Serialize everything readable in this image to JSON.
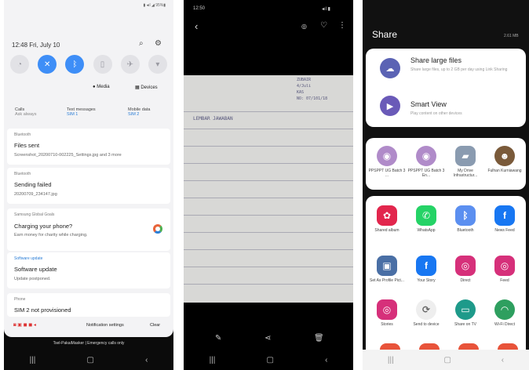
{
  "panel1": {
    "status_right": "▮ ◂ıl ◢ 95%▮",
    "time_date": "12:48  Fri, July 10",
    "media_label": "Media",
    "devices_label": "Devices",
    "sims": [
      {
        "label": "Calls",
        "value": "Ask always"
      },
      {
        "label": "Text messages",
        "value": "SIM 1"
      },
      {
        "label": "Mobile data",
        "value": "SIM 2"
      }
    ],
    "notifications": [
      {
        "app": "Bluetooth",
        "title": "Files sent",
        "text": "Screenshot_20200710-002225_Settings.jpg and 3 more"
      },
      {
        "app": "Bluetooth",
        "title": "Sending failed",
        "text": "20200709_234147.jpg"
      },
      {
        "app": "Samsung Global Goals",
        "title": "Charging your phone?",
        "text": "Earn money for charity while charging."
      },
      {
        "app": "Software update",
        "title": "Software update",
        "text": "Update postponed."
      },
      {
        "app": "Phone",
        "title": "SIM 2 not provisioned",
        "text": ""
      }
    ],
    "notification_settings": "Notification settings",
    "clear": "Clear",
    "carrier": "Tsel-PakaiMasker | Emergency calls only"
  },
  "panel2": {
    "status_time": "12:50",
    "handwriting_top": [
      "ZUBAIR",
      "4/Juli",
      "KAS",
      "NO: 07/101/18"
    ],
    "handwriting_main": "LEMBAR  JAWABAN"
  },
  "panel3": {
    "title": "Share",
    "storage": "2.61 MB",
    "share_large_title": "Share large files",
    "share_large_sub": "Share large files, up to 2 GB per day using Link Sharing",
    "smart_view_title": "Smart View",
    "smart_view_sub": "Play content on other devices",
    "contacts": [
      "PPSPPT UG Batch 3 ...",
      "PPSPPT UG Batch 3 En...",
      "My Drive Infrastructur...",
      "Fulhan Kurniawang"
    ],
    "apps": [
      "Shared album",
      "WhatsApp",
      "Bluetooth",
      "News Feed",
      "Set As Profile Pict...",
      "Your Story",
      "Direct",
      "Feed",
      "Stories",
      "Send to device",
      "Share on TV",
      "Wi-Fi Direct"
    ]
  }
}
